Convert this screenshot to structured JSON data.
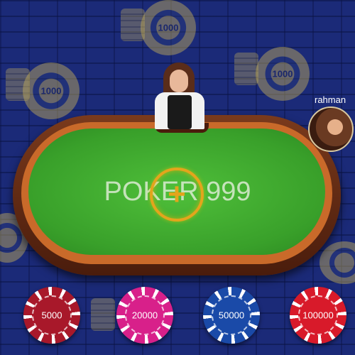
{
  "table": {
    "title_left": "POKE",
    "title_right": "R 999"
  },
  "background_chip_label": "1000",
  "player": {
    "name": "rahman"
  },
  "chips": [
    {
      "value": "5000",
      "color": "#a8182a"
    },
    {
      "value": "20000",
      "color": "#d8208a"
    },
    {
      "value": "50000",
      "color": "#1a4aa8"
    },
    {
      "value": "100000",
      "color": "#d81a2a"
    }
  ]
}
